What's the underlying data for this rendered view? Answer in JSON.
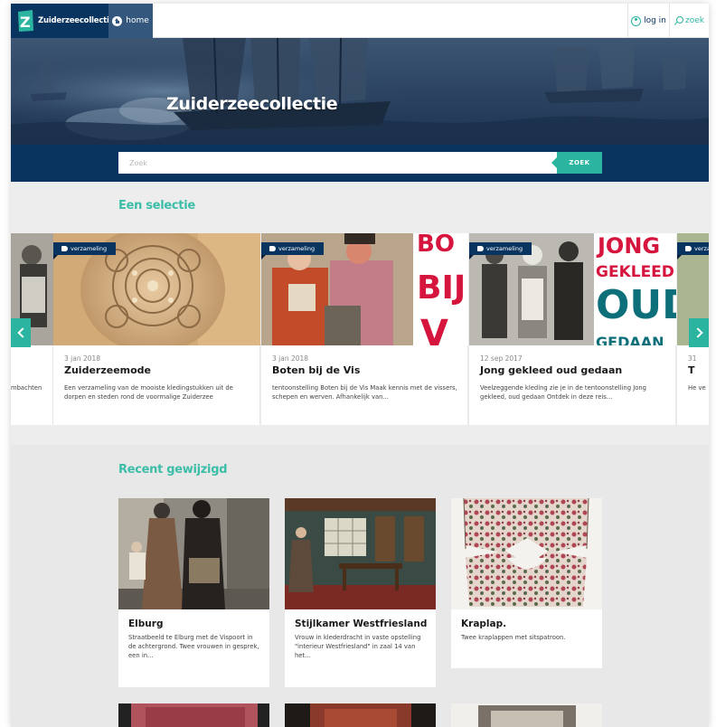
{
  "header": {
    "brand_name": "Zuiderzeecollectie",
    "home_label": "home",
    "login_label": "log in",
    "search_label": "zoek"
  },
  "hero": {
    "title": "Zuiderzeecollectie"
  },
  "search": {
    "placeholder": "Zoek",
    "button_label": "ZOEK"
  },
  "selection": {
    "title": "Een selectie",
    "partial_left_desc_line1": "mbachten",
    "cards": [
      {
        "badge": "verzameling",
        "date": "3 jan 2018",
        "title": "Zuiderzeemode",
        "description": "Een verzameling van de mooiste kledingstukken uit de dorpen en steden rond de voormalige Zuiderzee"
      },
      {
        "badge": "verzameling",
        "date": "3 jan 2018",
        "title": "Boten bij de Vis",
        "description": "tentoonstelling   Boten bij de Vis Maak kennis met de vissers, schepen en werven. Afhankelijk van...",
        "poster_text": [
          "BO",
          "BIJ",
          "V"
        ]
      },
      {
        "badge": "verzameling",
        "date": "12 sep 2017",
        "title": "Jong gekleed oud gedaan",
        "description": "Veelzeggende kleding zie je in de tentoonstelling Jong gekleed, oud gedaan Ontdek in deze reis...",
        "poster_text": [
          "JONG",
          "GEKLEED",
          "OUD",
          "GEDAAN"
        ]
      },
      {
        "badge": "verzameling",
        "date": "31",
        "title": "T",
        "description": "He ve"
      }
    ]
  },
  "recent": {
    "title": "Recent gewijzigd",
    "cards": [
      {
        "title": "Elburg",
        "description": "Straatbeeld te Elburg met de Vispoort in de achtergrond. Twee vrouwen in gesprek, een in..."
      },
      {
        "title": "Stijlkamer Westfriesland",
        "description": "Vrouw in klederdracht in vaste opstelling \"interieur Westfriesland\" in zaal 14 van het..."
      },
      {
        "title": "Kraplap.",
        "description": "Twee kraplappen met sitspatroon."
      }
    ]
  },
  "colors": {
    "navy": "#0a3460",
    "teal": "#2bb5a0",
    "poster_red": "#d6153f",
    "poster_teal": "#0c6f7a"
  },
  "icons": {
    "home": "home-icon",
    "login": "user-icon",
    "search": "search-icon",
    "badge": "tag-icon",
    "prev": "chevron-left-icon",
    "next": "chevron-right-icon"
  }
}
